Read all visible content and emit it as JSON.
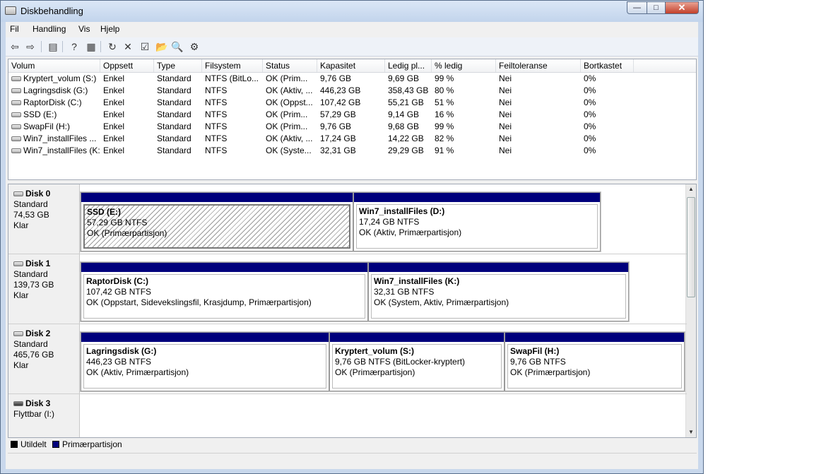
{
  "window": {
    "title": "Diskbehandling"
  },
  "menu": [
    {
      "label": "Fil"
    },
    {
      "label": "Handling"
    },
    {
      "label": "Vis"
    },
    {
      "label": "Hjelp"
    }
  ],
  "toolbar": [
    {
      "icon": "back-arrow-icon",
      "glyph": "⇦"
    },
    {
      "icon": "forward-arrow-icon",
      "glyph": "⇨"
    },
    {
      "icon": "show-hide-console-tree-icon",
      "glyph": "▤"
    },
    {
      "icon": "help-icon",
      "glyph": "?"
    },
    {
      "icon": "properties-pane-icon",
      "glyph": "▦"
    },
    {
      "icon": "refresh-icon",
      "glyph": "↻"
    },
    {
      "icon": "delete-icon",
      "glyph": "✕"
    },
    {
      "icon": "properties-icon",
      "glyph": "☑"
    },
    {
      "icon": "open-folder-icon",
      "glyph": "📂"
    },
    {
      "icon": "search-icon",
      "glyph": "🔍"
    },
    {
      "icon": "settings-icon",
      "glyph": "⚙"
    }
  ],
  "volumes": {
    "columns": [
      "Volum",
      "Oppsett",
      "Type",
      "Filsystem",
      "Status",
      "Kapasitet",
      "Ledig pl...",
      "% ledig",
      "Feiltoleranse",
      "Bortkastet"
    ],
    "rows": [
      [
        "Kryptert_volum (S:)",
        "Enkel",
        "Standard",
        "NTFS (BitLo...",
        "OK (Prim...",
        "9,76 GB",
        "9,69 GB",
        "99 %",
        "Nei",
        "0%"
      ],
      [
        "Lagringsdisk  (G:)",
        "Enkel",
        "Standard",
        "NTFS",
        "OK (Aktiv, ...",
        "446,23 GB",
        "358,43 GB",
        "80 %",
        "Nei",
        "0%"
      ],
      [
        "RaptorDisk (C:)",
        "Enkel",
        "Standard",
        "NTFS",
        "OK (Oppst...",
        "107,42 GB",
        "55,21 GB",
        "51 %",
        "Nei",
        "0%"
      ],
      [
        "SSD (E:)",
        "Enkel",
        "Standard",
        "NTFS",
        "OK (Prim...",
        "57,29 GB",
        "9,14 GB",
        "16 %",
        "Nei",
        "0%"
      ],
      [
        "SwapFil (H:)",
        "Enkel",
        "Standard",
        "NTFS",
        "OK (Prim...",
        "9,76 GB",
        "9,68 GB",
        "99 %",
        "Nei",
        "0%"
      ],
      [
        "Win7_installFiles ...",
        "Enkel",
        "Standard",
        "NTFS",
        "OK (Aktiv, ...",
        "17,24 GB",
        "14,22 GB",
        "82 %",
        "Nei",
        "0%"
      ],
      [
        "Win7_installFiles (K:)",
        "Enkel",
        "Standard",
        "NTFS",
        "OK (Syste...",
        "32,31 GB",
        "29,29 GB",
        "91 %",
        "Nei",
        "0%"
      ]
    ]
  },
  "disks": [
    {
      "name": "Disk 0",
      "lines": [
        "Standard",
        "74,53 GB",
        "Klar"
      ],
      "partitions": [
        {
          "name": "SSD  (E:)",
          "size": "57,29 GB NTFS",
          "status": "OK (Primærpartisjon)",
          "selected": true
        },
        {
          "name": "Win7_installFiles  (D:)",
          "size": "17,24 GB NTFS",
          "status": "OK (Aktiv, Primærpartisjon)"
        }
      ]
    },
    {
      "name": "Disk 1",
      "lines": [
        "Standard",
        "139,73 GB",
        "Klar"
      ],
      "partitions": [
        {
          "name": "RaptorDisk  (C:)",
          "size": "107,42 GB NTFS",
          "status": "OK (Oppstart, Sidevekslingsfil, Krasjdump, Primærpartisjon)"
        },
        {
          "name": "Win7_installFiles  (K:)",
          "size": "32,31 GB NTFS",
          "status": "OK (System, Aktiv, Primærpartisjon)"
        }
      ]
    },
    {
      "name": "Disk 2",
      "lines": [
        "Standard",
        "465,76 GB",
        "Klar"
      ],
      "partitions": [
        {
          "name": "Lagringsdisk  (G:)",
          "size": "446,23 GB NTFS",
          "status": "OK (Aktiv, Primærpartisjon)"
        },
        {
          "name": "Kryptert_volum  (S:)",
          "size": "9,76 GB NTFS (BitLocker-kryptert)",
          "status": "OK (Primærpartisjon)"
        },
        {
          "name": "SwapFil  (H:)",
          "size": "9,76 GB NTFS",
          "status": "OK (Primærpartisjon)"
        }
      ]
    },
    {
      "name": "Disk 3",
      "lines": [
        "Flyttbar (I:)"
      ],
      "partitions": []
    }
  ],
  "legend": [
    {
      "label": "Utildelt",
      "color": "#000000"
    },
    {
      "label": "Primærpartisjon",
      "color": "#00007c"
    }
  ]
}
